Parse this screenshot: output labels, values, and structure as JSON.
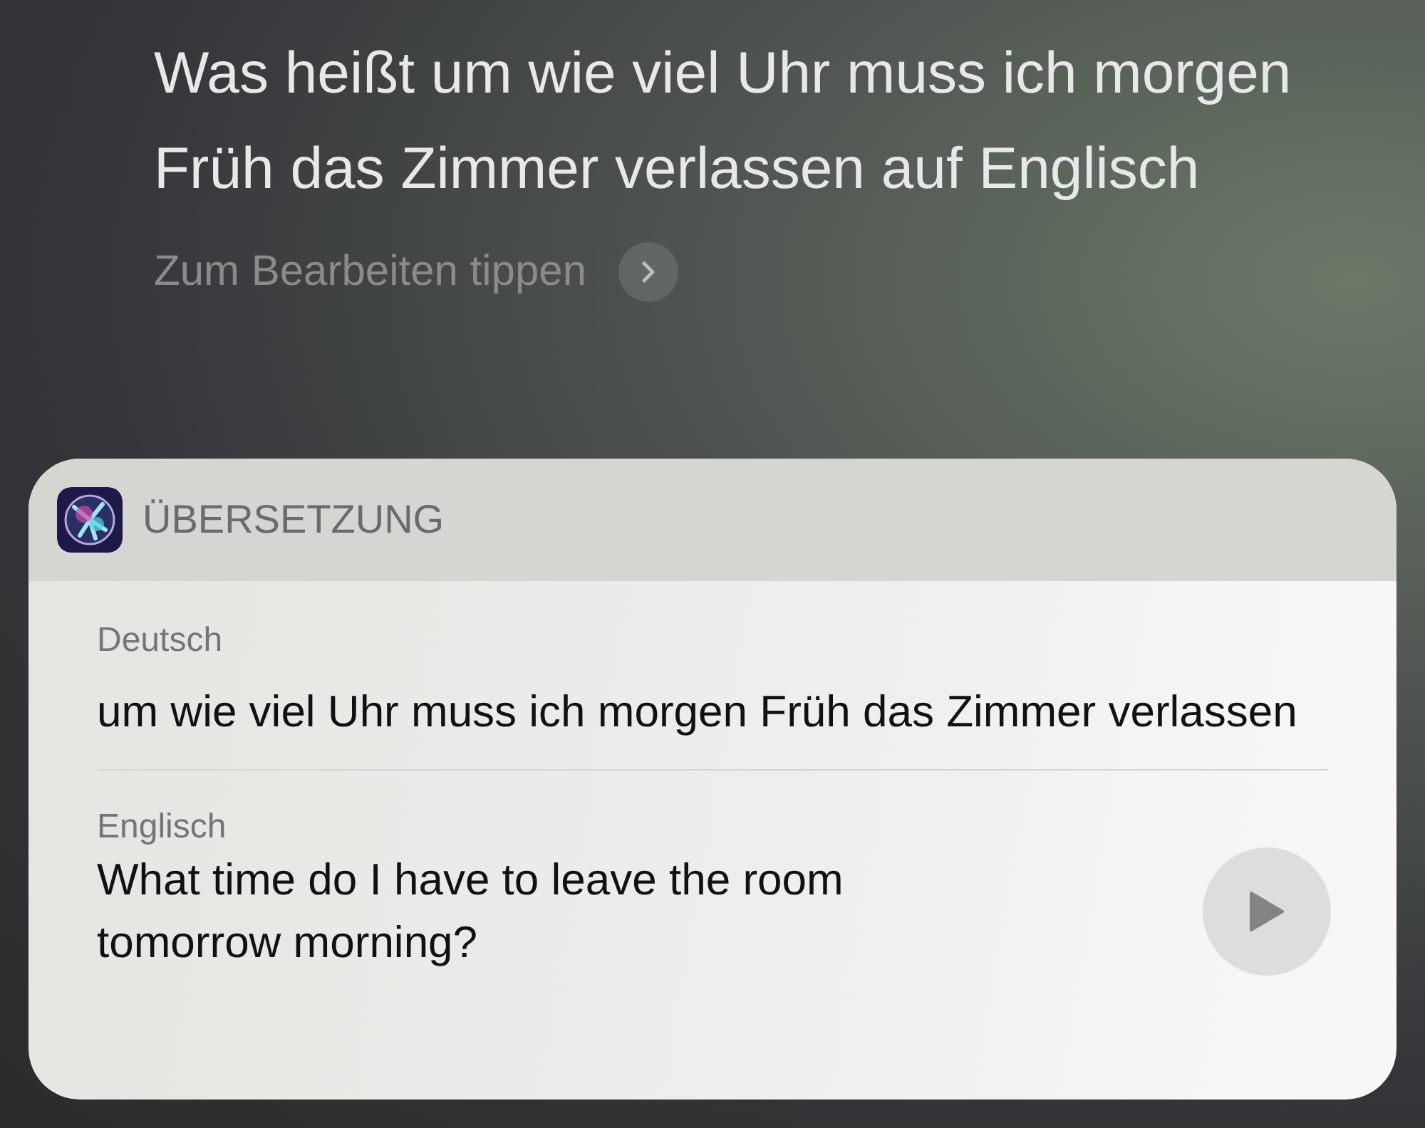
{
  "query": {
    "text": "Was heißt um wie viel Uhr muss ich morgen Früh das Zimmer verlassen auf Englisch",
    "edit_hint": "Zum Bearbeiten tippen"
  },
  "card": {
    "title": "ÜBERSETZUNG",
    "sections": [
      {
        "kind": "plain",
        "language": "Deutsch",
        "text": "um wie viel Uhr muss ich morgen Früh das Zimmer verlassen"
      },
      {
        "kind": "playable",
        "language": "Englisch",
        "text": "What time do I have to leave the room tomorrow morning?"
      }
    ]
  }
}
